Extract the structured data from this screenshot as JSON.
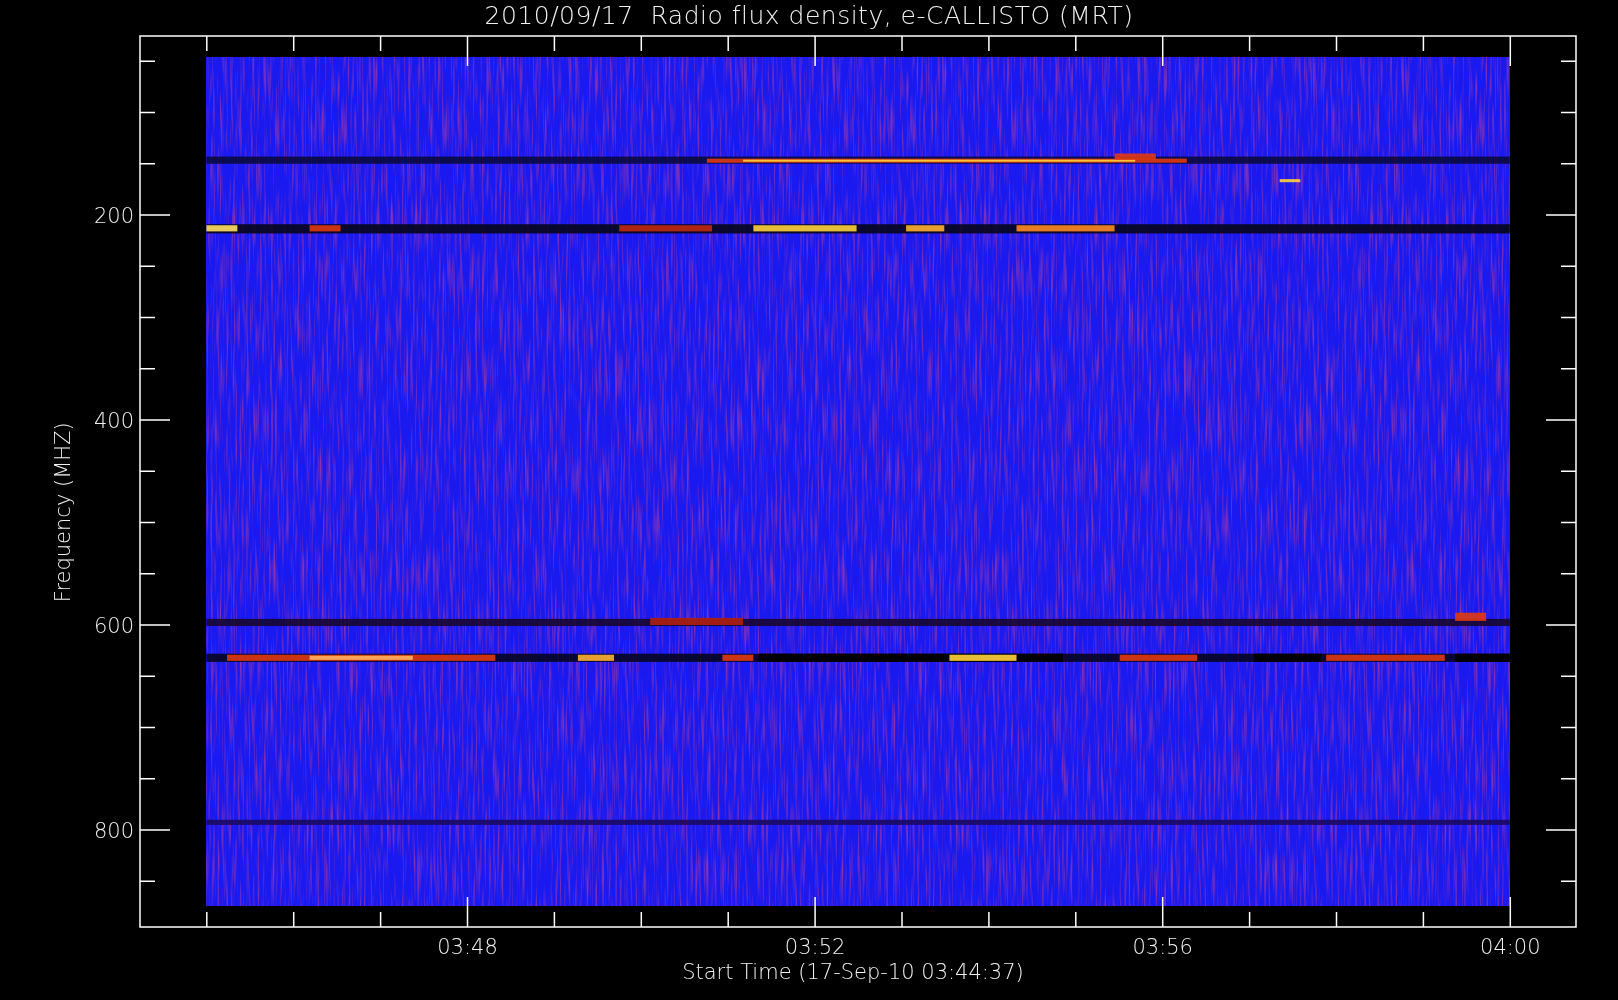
{
  "title": "2010/09/17  Radio flux density, e-CALLISTO (MRT)",
  "y_axis": {
    "label": "Frequency (MHZ)",
    "ticks": [
      "200",
      "400",
      "600",
      "800"
    ]
  },
  "x_axis": {
    "label": "Start Time (17-Sep-10 03:44:37)",
    "ticks": [
      "03:48",
      "03:52",
      "03:56",
      "04:00"
    ]
  }
}
